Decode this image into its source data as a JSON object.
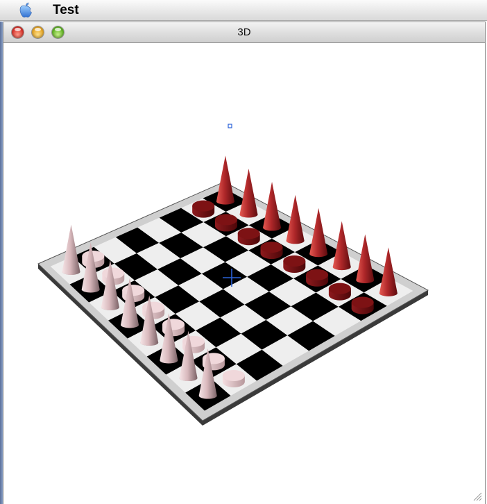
{
  "menubar": {
    "apple_icon": "apple-logo-icon",
    "app_name": "Test"
  },
  "window": {
    "title": "3D",
    "controls": [
      "close-button",
      "minimize-button",
      "zoom-button"
    ]
  },
  "scene": {
    "board": {
      "rows": 8,
      "cols": 8,
      "light_color": "#eeeeee",
      "dark_color": "#000000"
    },
    "pieces": {
      "white_color": "#e9cfd3",
      "red_color": "#b0282a",
      "white_cones": 8,
      "white_discs": 8,
      "red_cones": 8,
      "red_discs": 8
    },
    "cursor_icon": "crosshair-icon",
    "marker_icon": "square-marker-icon"
  }
}
